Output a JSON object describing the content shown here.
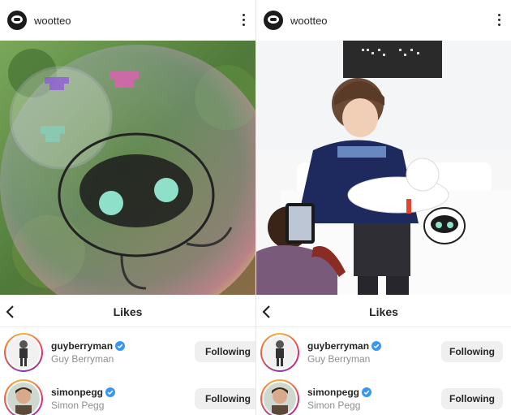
{
  "left_post": {
    "username": "wootteo",
    "likes_title": "Likes",
    "users": [
      {
        "handle": "guyberryman",
        "full_name": "Guy Berryman",
        "button": "Following"
      },
      {
        "handle": "simonpegg",
        "full_name": "Simon Pegg",
        "button": "Following"
      }
    ]
  },
  "right_post": {
    "username": "wootteo",
    "likes_title": "Likes",
    "users": [
      {
        "handle": "guyberryman",
        "full_name": "Guy Berryman",
        "button": "Following"
      },
      {
        "handle": "simonpegg",
        "full_name": "Simon Pegg",
        "button": "Following"
      }
    ]
  },
  "icons": {
    "profile": "wootteo-avatar-icon",
    "more": "more-options-icon",
    "back": "back-chevron-icon",
    "verified": "verified-badge-icon"
  },
  "colors": {
    "verified_blue": "#3897f0",
    "button_bg": "#efefef",
    "secondary_text": "#8e8e8e"
  }
}
